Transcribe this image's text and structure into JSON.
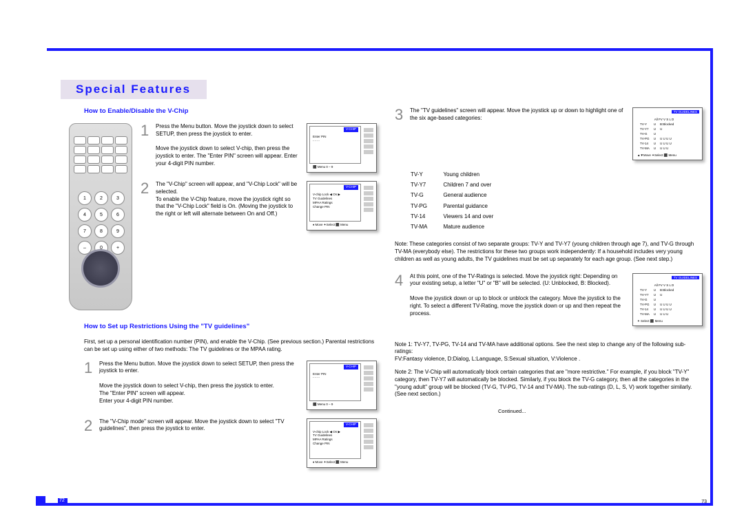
{
  "title": "Special Features",
  "left": {
    "heading1": "How to Enable/Disable the V-Chip",
    "step1_num": "1",
    "step1_text": "Press the Menu button.  Move the joystick down to select SETUP, then press the joystick to enter.\n\nMove the joystick down to select V-chip, then press the joystick to enter.  The \"Enter PIN\" screen will appear.  Enter your 4-digit PIN number.",
    "step2_num": "2",
    "step2_text": "The \"V-Chip\" screen will appear, and \"V-Chip Lock\" will be selected.\nTo enable the V-Chip feature, move the joystick right so that the \"V-Chip Lock\" field is On. (Moving the joystick to the right or left will alternate between On and Off.)",
    "heading2": "How to Set up Restrictions Using the \"TV guidelines\"",
    "intro2": "First, set up a personal identification number (PIN), and enable the V-Chip. (See previous section.)  Parental restrictions can be set up using either of two methods: The TV guidelines or the MPAA rating.",
    "b_step1_num": "1",
    "b_step1_text": "Press the Menu button.  Move the joystick down to select SETUP, then press the joystick to enter.\n\nMove the joystick down to select V-chip, then press the joystick to enter.\nThe \"Enter PIN\" screen will appear.\nEnter your 4-digit PIN number.",
    "b_step2_num": "2",
    "b_step2_text": "The \"V-Chip mode\" screen will appear. Move the joystick down to select \"TV guidelines\", then press the joystick to enter.",
    "thumb_vchip_label": "V-CHIP",
    "thumb1_body": "Enter PIN\n- - - -",
    "thumb1_footer": "⬛ Menu      0 – 9",
    "thumb2_body": "V-chip Lock  ◀  On  ▶\nTV Guidelines\nMPAA Ratings\nChange PIN",
    "thumb2_footer": "♦ Move  ✦Select  ⬛ Menu",
    "thumb3_body": "Enter PIN\n- - - -",
    "thumb3_footer": "⬛ Menu      0 – 9",
    "thumb4_body": "V-chip Lock  ◀  On  ▶\nTV Guidelines\nMPAA Ratings\nChange PIN",
    "thumb4_footer": "♦ Move  ✦Select  ⬛ Menu"
  },
  "right": {
    "step3_num": "3",
    "step3_text": "The \"TV guidelines\" screen will appear. Move the joystick up or down to highlight one of the six age-based categories:",
    "ratings": [
      [
        "TV-Y",
        "Young children"
      ],
      [
        "TV-Y7",
        "Children 7 and over"
      ],
      [
        "TV-G",
        "General audience"
      ],
      [
        "TV-PG",
        "Parental guidance"
      ],
      [
        "TV-14",
        "Viewers 14 and over"
      ],
      [
        "TV-MA",
        "Mature audience"
      ]
    ],
    "note_after_ratings": "Note: These categories consist of two separate groups: TV-Y and TV-Y7 (young children through age 7), and  TV-G through TV-MA (everybody else). The restrictions for these two groups work independently: If a household includes very young children as well as young adults, the TV guidelines must be set up separately for each age group. (See next step.)",
    "step4_num": "4",
    "step4_text": "At this point, one of the TV-Ratings is selected. Move the joystick right: Depending on your existing setup, a letter \"U\" or \"B\" will be selected. (U: Unblocked, B: Blocked).\n\nMove the joystick down or up to block or unblock the category. Move the joystick to the right. To select a different TV-Rating, move the joystick down or up and then repeat the process.",
    "note1": "Note 1: TV-Y7, TV-PG, TV-14 and TV-MA have additional options.  See the next step to change any of the following sub-ratings:\nFV:Fantasy violence, D:Dialog, L:Language, S:Sexual situation, V:Violence .",
    "note2": "Note 2: The V-Chip will automatically block certain categories that are \"more restrictive.\"  For example, if you block \"TV-Y\" category, then TV-Y7 will automatically be blocked.  Similarly, if you block the TV-G category, then all the categories in the \"young adult\" group will be blocked (TV-G, TV-PG, TV-14 and TV-MA). The sub-ratings (D, L, S, V) work together similarly. (See next section.)",
    "continued": "Continued...",
    "guide_header": "TV GUIDELINES",
    "guide_cols": "All FV  V  S  L  D",
    "guide_rows": [
      [
        "TV-Y",
        "U",
        "",
        "B:Blocked"
      ],
      [
        "TV-Y7",
        "U",
        "U",
        "U:unblocked"
      ],
      [
        "TV-G",
        "U",
        "",
        ""
      ],
      [
        "TV-PG",
        "U",
        "U  U  U  U",
        ""
      ],
      [
        "TV-14",
        "U",
        "U  U  U  U",
        ""
      ],
      [
        "TV-MA",
        "U",
        "U  U  U",
        ""
      ]
    ],
    "guide_footer1": "▲▼Move   ✦Select  ⬛ Menu",
    "guide_footer2": "✦ Select    ⬛ Menu"
  },
  "page_left": "72",
  "page_right": "73"
}
